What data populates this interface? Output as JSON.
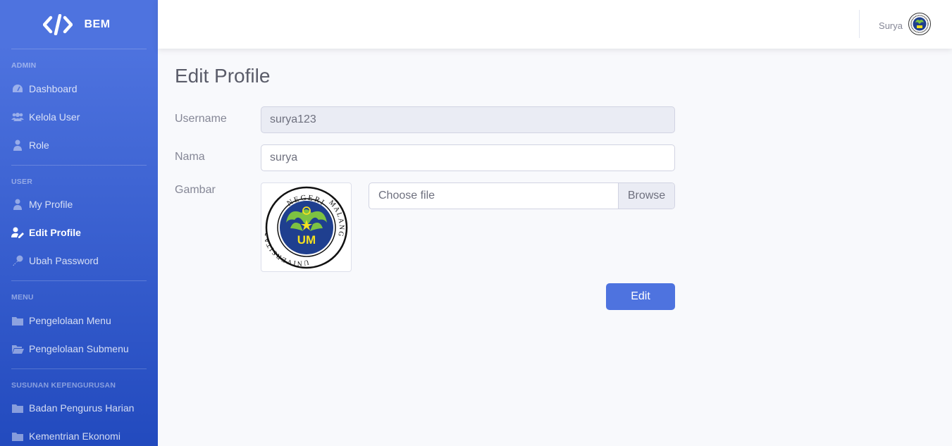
{
  "brand": {
    "name": "BEM",
    "icon": "code-icon"
  },
  "sidebar": {
    "sections": [
      {
        "heading": "ADMIN",
        "items": [
          {
            "label": "Dashboard",
            "icon": "tachometer-icon"
          },
          {
            "label": "Kelola User",
            "icon": "users-icon"
          },
          {
            "label": "Role",
            "icon": "user-tie-icon"
          }
        ]
      },
      {
        "heading": "USER",
        "items": [
          {
            "label": "My Profile",
            "icon": "user-icon"
          },
          {
            "label": "Edit Profile",
            "icon": "user-edit-icon",
            "active": true
          },
          {
            "label": "Ubah Password",
            "icon": "key-icon"
          }
        ]
      },
      {
        "heading": "MENU",
        "items": [
          {
            "label": "Pengelolaan Menu",
            "icon": "folder-icon"
          },
          {
            "label": "Pengelolaan Submenu",
            "icon": "folder-open-icon"
          }
        ]
      },
      {
        "heading": "SUSUNAN KEPENGURUSAN",
        "items": [
          {
            "label": "Badan Pengurus Harian",
            "icon": "folder-icon"
          },
          {
            "label": "Kementrian Ekonomi",
            "icon": "folder-icon"
          }
        ]
      }
    ]
  },
  "topbar": {
    "user_name": "Surya",
    "avatar": "university-seal-avatar"
  },
  "page": {
    "title": "Edit Profile"
  },
  "form": {
    "username_label": "Username",
    "username_value": "surya123",
    "nama_label": "Nama",
    "nama_value": "surya",
    "gambar_label": "Gambar",
    "file_placeholder": "Choose file",
    "browse_label": "Browse",
    "submit_label": "Edit"
  },
  "logo": {
    "top_text": "NEGERI",
    "left_text": "UNIVERSITAS",
    "right_text": "MALANG",
    "center_text": "UM"
  },
  "colors": {
    "primary": "#4e73df",
    "sidebar_gradient_end": "#224abe",
    "background": "#f8f9fc",
    "text_muted": "#858796"
  }
}
